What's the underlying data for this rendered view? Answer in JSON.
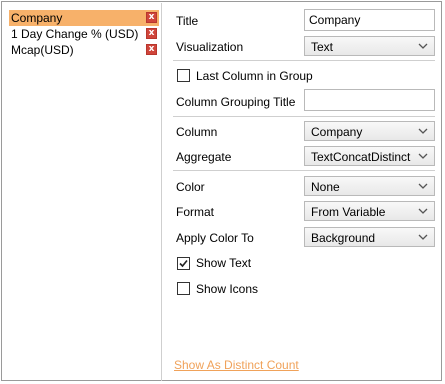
{
  "columns_list": [
    {
      "label": "Company",
      "remove": "x",
      "selected": true
    },
    {
      "label": "1 Day Change % (USD)",
      "remove": "x",
      "selected": false
    },
    {
      "label": "Mcap(USD)",
      "remove": "x",
      "selected": false
    }
  ],
  "form": {
    "title_label": "Title",
    "title_value": "Company",
    "visualization_label": "Visualization",
    "visualization_value": "Text",
    "last_column_label": "Last Column in Group",
    "last_column_checked": false,
    "grouping_title_label": "Column Grouping Title",
    "grouping_title_value": "",
    "column_label": "Column",
    "column_value": "Company",
    "aggregate_label": "Aggregate",
    "aggregate_value": "TextConcatDistinct",
    "color_label": "Color",
    "color_value": "None",
    "format_label": "Format",
    "format_value": "From Variable",
    "apply_color_label": "Apply Color To",
    "apply_color_value": "Background",
    "show_text_label": "Show Text",
    "show_text_checked": true,
    "show_icons_label": "Show Icons",
    "show_icons_checked": false
  },
  "footer": {
    "distinct_link": "Show As Distinct Count"
  },
  "colors": {
    "selected_row": "#f7b16a",
    "remove_button": "#d0453b",
    "link": "#f0a25a"
  }
}
